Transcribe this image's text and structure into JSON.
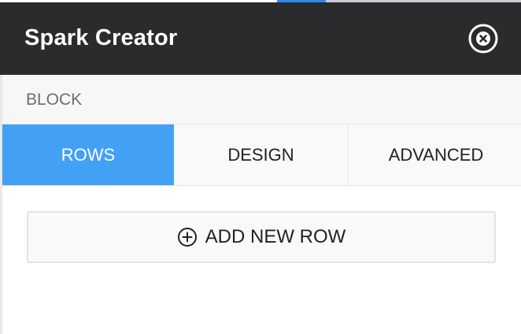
{
  "header": {
    "title": "Spark Creator",
    "close_icon": "close-circle-icon"
  },
  "section": {
    "label": "BLOCK"
  },
  "tabs": [
    {
      "label": "ROWS",
      "active": true
    },
    {
      "label": "DESIGN",
      "active": false
    },
    {
      "label": "ADVANCED",
      "active": false
    }
  ],
  "add_row": {
    "label": "ADD NEW ROW",
    "icon": "plus-circle-icon"
  },
  "colors": {
    "header_bg": "#2a2b2d",
    "active_tab": "#42a0f5",
    "text": "#222222"
  }
}
